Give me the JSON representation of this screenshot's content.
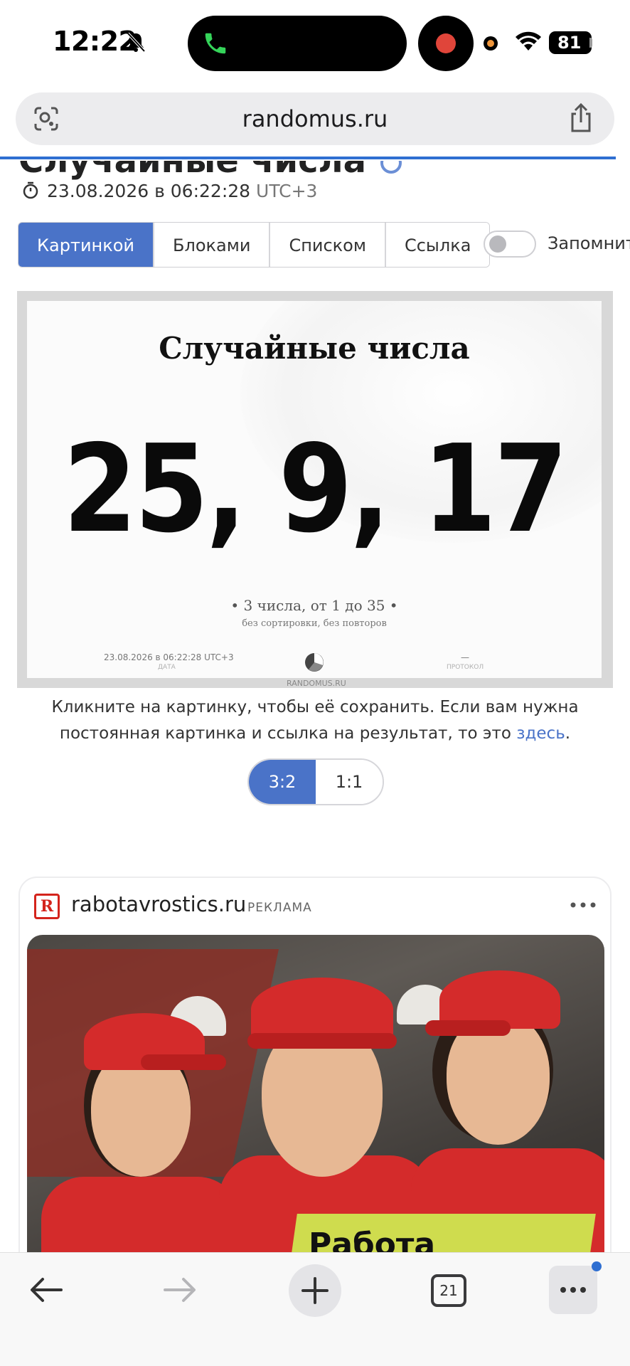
{
  "status_bar": {
    "time": "12:22",
    "battery": "81"
  },
  "browser": {
    "url": "randomus.ru"
  },
  "page": {
    "title": "Случайные числа",
    "timestamp": "23.08.2026 в 06:22:28",
    "timezone": "UTC+3",
    "tabs": [
      "Картинкой",
      "Блоками",
      "Списком",
      "Ссылка"
    ],
    "active_tab": "Картинкой",
    "remember_label": "Запомнить",
    "remember_on": false
  },
  "result_card": {
    "title": "Случайные числа",
    "numbers": "25, 9, 17",
    "description": "• 3 числа, от 1 до 35 •",
    "subdescription": "без сортировки, без повторов",
    "date_value": "23.08.2026 в 06:22:28 UTC+3",
    "date_label": "ДАТА",
    "protocol_value": "—",
    "protocol_label": "ПРОТОКОЛ",
    "site": "RANDOMUS.RU"
  },
  "save_note": {
    "text": "Кликните на картинку, чтобы её сохранить. Если вам нужна постоянная картинка и ссылка на результат, то это",
    "link": "здесь",
    "end": "."
  },
  "ratio": {
    "options": [
      "3:2",
      "1:1"
    ],
    "selected": "3:2"
  },
  "ad": {
    "domain": "rabotavrostics.ru",
    "label": "РЕКЛАМА",
    "logo_letter": "R",
    "banner_text": "Работа"
  },
  "toolbar": {
    "tab_count": "21"
  },
  "colors": {
    "accent": "#4a73c8",
    "progress": "#2f6fd1",
    "ad_red": "#d42b2b",
    "banner_yellow": "#cfdc4e"
  },
  "icons": [
    "bell-slash-icon",
    "phone-icon",
    "wifi-icon",
    "lens-icon",
    "share-icon",
    "stopwatch-icon",
    "more-icon",
    "back-icon",
    "forward-icon",
    "plus-icon",
    "tabs-icon",
    "menu-icon"
  ]
}
